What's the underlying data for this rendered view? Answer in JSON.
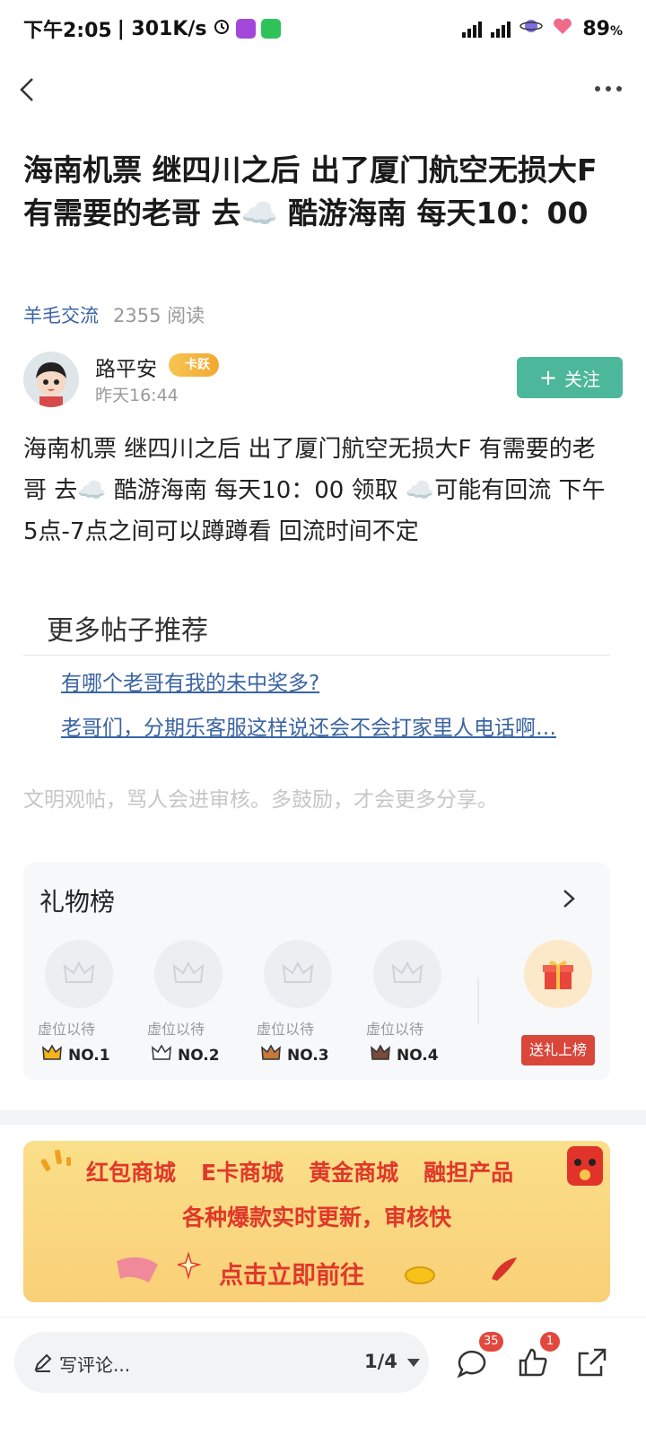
{
  "status_bar": {
    "time": "下午2:05",
    "speed": "| 301K/s",
    "battery": "89",
    "battery_unit": "%",
    "icons": [
      "alarm-icon",
      "app-icon",
      "wechat-icon",
      "signal-icon",
      "signal-icon",
      "planet-icon",
      "heart-icon"
    ]
  },
  "post": {
    "title": "海南机票 继四川之后 出了厦门航空无损大F 有需要的老哥 去☁️ 酷游海南 每天10：00",
    "category": "羊毛交流",
    "reads": "2355 阅读",
    "body": "海南机票 继四川之后 出了厦门航空无损大F 有需要的老哥 去☁️ 酷游海南 每天10：00 领取 ☁️可能有回流 下午5点-7点之间可以蹲蹲看 回流时间不定"
  },
  "author": {
    "name": "路平安",
    "badge": "卡跃",
    "time": "昨天16:44",
    "follow_label": "关注"
  },
  "recommend": {
    "title": "更多帖子推荐",
    "links": [
      "有哪个老哥有我的未中奖多?",
      "老哥们，分期乐客服这样说还会不会打家里人电话啊…"
    ]
  },
  "civil_notice": "文明观帖，骂人会进审核。多鼓励，才会更多分享。",
  "gift_board": {
    "title": "礼物榜",
    "slots": [
      {
        "vacant": "虚位以待",
        "rank": "NO.1",
        "color": "#f2b31c"
      },
      {
        "vacant": "虚位以待",
        "rank": "NO.2",
        "color": "#222222"
      },
      {
        "vacant": "虚位以待",
        "rank": "NO.3",
        "color": "#c47a3c"
      },
      {
        "vacant": "虚位以待",
        "rank": "NO.4",
        "color": "#7a4a3a"
      }
    ],
    "send_label": "送礼上榜"
  },
  "banner": {
    "row1": [
      "红包商城",
      "E卡商城",
      "黄金商城",
      "融担产品"
    ],
    "row2": "各种爆款实时更新，审核快",
    "row3": "点击立即前往"
  },
  "bottom_bar": {
    "comment_placeholder": "写评论...",
    "page": "1/4",
    "comment_count": "35",
    "like_count": "1"
  },
  "colors": {
    "accent_green": "#4cb79a",
    "link_blue": "#3b64a3",
    "badge_red": "#e2483e"
  }
}
